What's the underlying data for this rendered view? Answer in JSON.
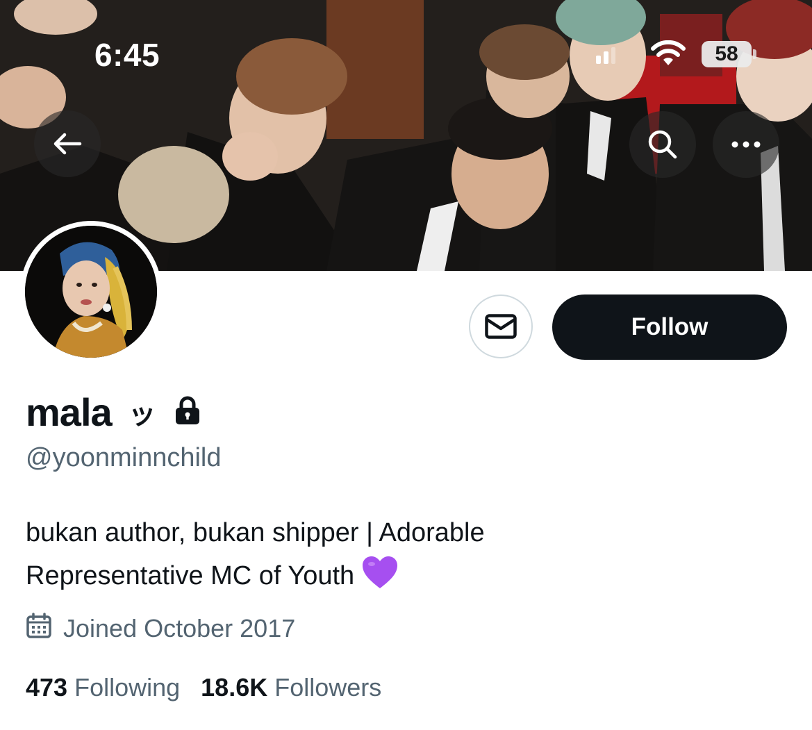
{
  "status_bar": {
    "time": "6:45",
    "battery": "58",
    "signal_icon": "cellular-signal-icon",
    "wifi_icon": "wifi-icon"
  },
  "header": {
    "back_icon": "arrow-left-icon",
    "search_icon": "search-icon",
    "more_icon": "ellipsis-icon"
  },
  "profile": {
    "display_name": "mala",
    "name_symbol": "ッ",
    "protected_icon": "lock-icon",
    "handle": "@yoonminnchild",
    "bio_line_1": "bukan author, bukan shipper | Adorable",
    "bio_line_2": "Representative MC of Youth",
    "bio_emoji": "purple-heart-icon",
    "joined": "Joined October 2017",
    "following_count": "473",
    "following_label": "Following",
    "followers_count": "18.6K",
    "followers_label": "Followers"
  },
  "actions": {
    "message_icon": "envelope-icon",
    "follow_label": "Follow"
  },
  "colors": {
    "text_primary": "#0f1419",
    "text_secondary": "#536471",
    "follow_button_bg": "#0f1419",
    "border": "#cfd9de",
    "heart": "#a64ff0"
  }
}
